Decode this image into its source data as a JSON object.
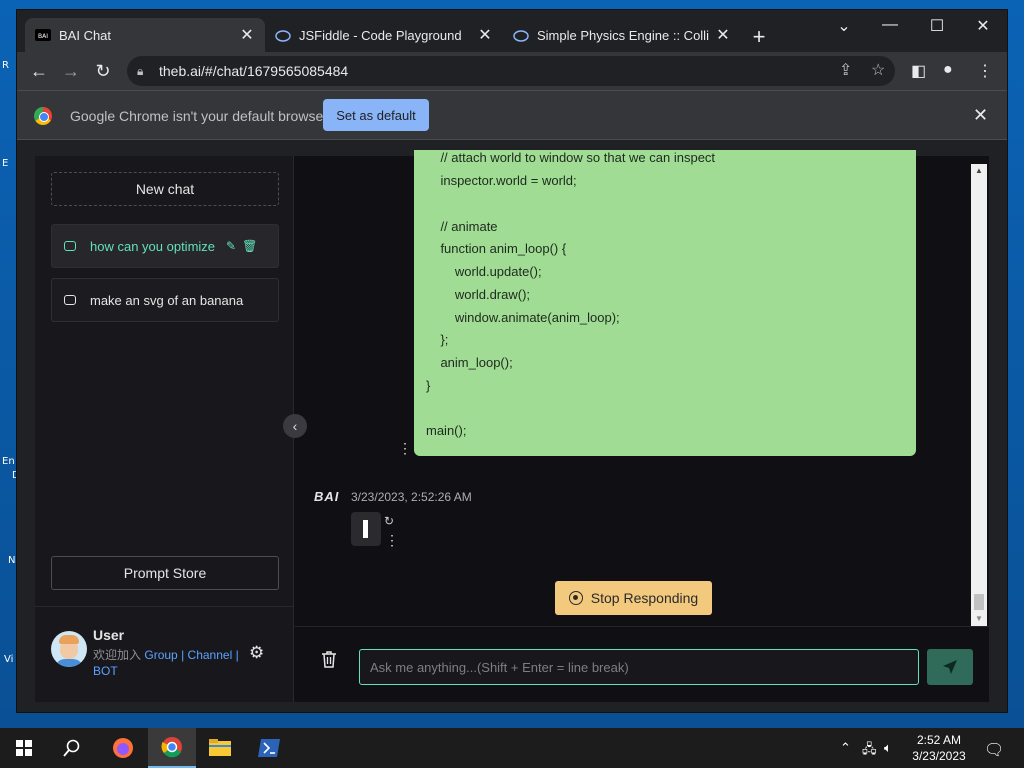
{
  "browser": {
    "tabs": [
      {
        "title": "BAI Chat",
        "icon": "bai-favicon",
        "active": true
      },
      {
        "title": "JSFiddle - Code Playground",
        "icon": "jsfiddle-favicon",
        "active": false
      },
      {
        "title": "Simple Physics Engine :: Collision",
        "icon": "jsfiddle-favicon",
        "active": false
      }
    ],
    "url": "theb.ai/#/chat/1679565085484",
    "infobar": {
      "message": "Google Chrome isn't your default browser",
      "button": "Set as default"
    }
  },
  "sidebar": {
    "new_chat": "New chat",
    "chats": [
      {
        "label": "how can you optimize",
        "active": true
      },
      {
        "label": "make an svg of an banana",
        "active": false
      }
    ],
    "prompt_store": "Prompt Store",
    "user": {
      "name": "User",
      "sub_prefix": "欢迎加入",
      "link_group": "Group",
      "sep1": "|",
      "link_channel": "Channel",
      "sep2": "|",
      "link_bot": "BOT"
    }
  },
  "conversation": {
    "code_lines": [
      "    // attach world to window so that we can inspect",
      "    inspector.world = world;",
      "",
      "    // animate",
      "    function anim_loop() {",
      "        world.update();",
      "        world.draw();",
      "        window.animate(anim_loop);",
      "    };",
      "    anim_loop();",
      "}",
      "",
      "main();"
    ],
    "bot_logo": "BAI",
    "timestamp": "3/23/2023, 2:52:26 AM",
    "stop_button": "Stop Responding",
    "input_placeholder": "Ask me anything...(Shift + Enter = line break)",
    "input_value": ""
  },
  "colors": {
    "accent": "#63e2b7",
    "code_bg": "#a1dc95",
    "stop_bg": "#f2c97d"
  },
  "taskbar": {
    "time": "2:52 AM",
    "date": "3/23/2023"
  },
  "desktop": {
    "labels": [
      "R",
      "E",
      "En",
      "D",
      "N",
      "Vi"
    ]
  }
}
